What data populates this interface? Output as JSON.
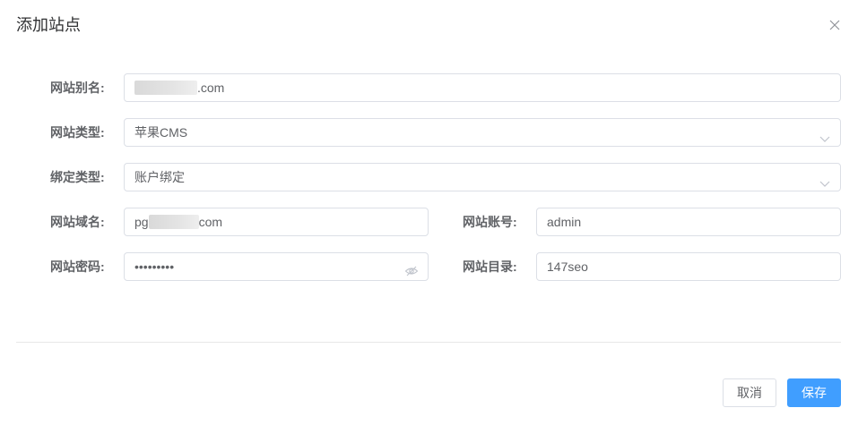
{
  "dialog": {
    "title": "添加站点",
    "close_icon": "close-icon"
  },
  "form": {
    "alias": {
      "label": "网站别名:",
      "value_suffix": ".com"
    },
    "type": {
      "label": "网站类型:",
      "value": "苹果CMS",
      "icon": "chevron-down-icon"
    },
    "bind_type": {
      "label": "绑定类型:",
      "value": "账户绑定",
      "icon": "chevron-down-icon"
    },
    "domain": {
      "label": "网站域名:",
      "value_prefix": "pg",
      "value_suffix": "com"
    },
    "account": {
      "label": "网站账号:",
      "value": "admin"
    },
    "password": {
      "label": "网站密码:",
      "value": "•••••••••",
      "icon": "eye-hidden-icon"
    },
    "directory": {
      "label": "网站目录:",
      "value": "147seo"
    }
  },
  "footer": {
    "cancel_label": "取消",
    "save_label": "保存"
  },
  "colors": {
    "primary": "#409eff",
    "border": "#dcdfe6",
    "text": "#606266"
  }
}
